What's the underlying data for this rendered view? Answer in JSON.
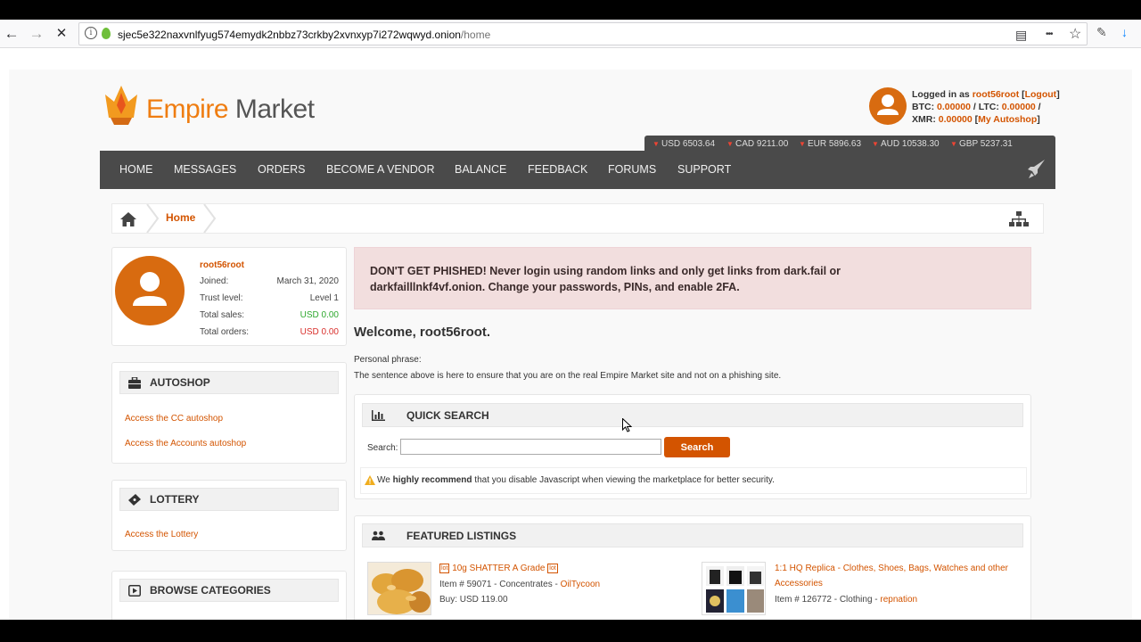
{
  "browser": {
    "url_host": "sjec5e322naxvnlfyug574emydk2nbbz73crkby2xvnxyp7i272wqwyd.onion",
    "url_path": "/home",
    "back_glyph": "←",
    "forward_glyph": "→",
    "stop_glyph": "✕",
    "info_glyph": "i",
    "reader_glyph": "▤",
    "more_glyph": "•••",
    "bookmark_glyph": "☆",
    "tracking_glyph": "✎",
    "download_glyph": "↓"
  },
  "header": {
    "logo_word1": "Empire",
    "logo_word2": "Market",
    "logged_in_prefix": "Logged in as",
    "username": "root56root",
    "logout_label": "Logout",
    "btc_label": "BTC:",
    "btc_value": "0.00000",
    "ltc_label": "LTC:",
    "ltc_value": "0.00000",
    "xmr_label": "XMR:",
    "xmr_value": "0.00000",
    "autoshop_link": "My Autoshop"
  },
  "ticker": [
    "USD 6503.64",
    "CAD 9211.00",
    "EUR 5896.63",
    "AUD 10538.30",
    "GBP 5237.31"
  ],
  "nav": [
    "HOME",
    "MESSAGES",
    "ORDERS",
    "BECOME A VENDOR",
    "BALANCE",
    "FEEDBACK",
    "FORUMS",
    "SUPPORT"
  ],
  "breadcrumb": {
    "current": "Home"
  },
  "profile": {
    "name": "root56root",
    "joined_label": "Joined:",
    "joined_value": "March 31, 2020",
    "trust_label": "Trust level:",
    "trust_value": "Level 1",
    "sales_label": "Total sales:",
    "sales_value": "USD 0.00",
    "orders_label": "Total orders:",
    "orders_value": "USD 0.00"
  },
  "autoshop": {
    "title": "AUTOSHOP",
    "links": [
      "Access the CC autoshop",
      "Access the Accounts autoshop"
    ]
  },
  "lottery": {
    "title": "LOTTERY",
    "link": "Access the Lottery"
  },
  "categories": {
    "title": "BROWSE CATEGORIES"
  },
  "phishing_alert": {
    "line1": "DON'T GET PHISHED! Never login using random links and only get links from dark.fail or",
    "line2": "darkfailllnkf4vf.onion. Change your passwords, PINs, and enable 2FA."
  },
  "welcome": "Welcome, root56root.",
  "personal_phrase_label": "Personal phrase:",
  "personal_phrase_note": "The sentence above is here to ensure that you are on the real Empire Market site and not on a phishing site.",
  "quick_search": {
    "title": "QUICK SEARCH",
    "label": "Search:",
    "button": "Search",
    "note_prefix": "We",
    "note_bold": "highly recommend",
    "note_suffix": "that you disable Javascript when viewing the marketplace for better security."
  },
  "featured": {
    "title": "FEATURED LISTINGS",
    "items": [
      {
        "badge": "lot",
        "title": "10g SHATTER A Grade",
        "meta": "Item # 59071 - Concentrates -",
        "vendor": "OilTycoon",
        "price": "Buy: USD 119.00"
      },
      {
        "title_line1": "1:1 HQ Replica - Clothes, Shoes, Bags, Watches and other",
        "title_line2": "Accessories",
        "meta": "Item # 126772 - Clothing -",
        "vendor": "repnation"
      }
    ]
  },
  "colors": {
    "accent": "#d35400",
    "logo_orange": "#ef7d11",
    "nav_bg": "#4a4a4a",
    "alert_bg": "#f2dede",
    "positive": "#2ea82e",
    "negative": "#d9302c"
  }
}
